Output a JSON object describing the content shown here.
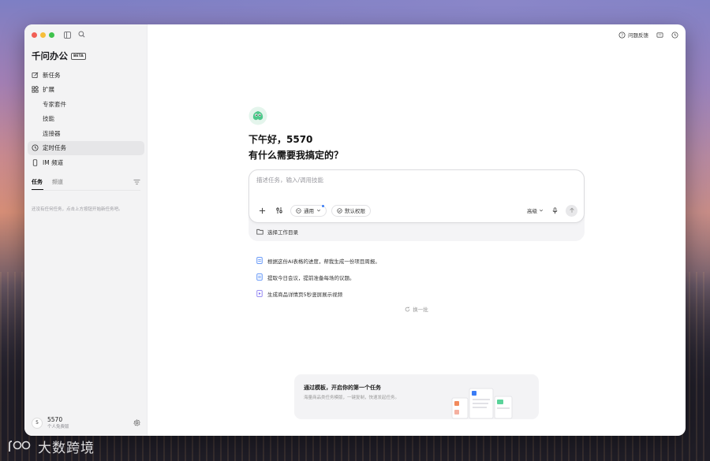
{
  "app": {
    "title": "千问办公",
    "badge": "BETA"
  },
  "sidebar": {
    "items": [
      {
        "label": "新任务",
        "icon": "edit-icon"
      },
      {
        "label": "扩展",
        "icon": "extension-icon"
      },
      {
        "label": "专家套件",
        "icon": ""
      },
      {
        "label": "技能",
        "icon": ""
      },
      {
        "label": "连接器",
        "icon": ""
      },
      {
        "label": "定时任务",
        "icon": "clock-icon"
      },
      {
        "label": "IM 频道",
        "icon": "phone-icon"
      }
    ],
    "tabs": [
      "任务",
      "频道"
    ],
    "empty_text": "还没有任何任务，点击上方按钮开始新任务吧。",
    "user": {
      "avatar": "5",
      "name": "5570",
      "plan": "个人免费版"
    }
  },
  "topbar": {
    "feedback_label": "问题反馈"
  },
  "main": {
    "greeting": "下午好，5570",
    "question": "有什么需要我搞定的？",
    "prompt_placeholder": "描述任务，输入/调用技能",
    "mode_label": "通用",
    "permission_label": "默认权限",
    "advanced_label": "高级",
    "workdir_label": "选择工作目录",
    "suggestions": [
      "根据这份AI表格的进度，帮我生成一份项目周报。",
      "提取今日会议，提前准备每场的议题。",
      "生成商品详情页5秒竖屏展示视频"
    ],
    "refresh_label": "换一批"
  },
  "banner": {
    "title": "通过模板，开启你的第一个任务",
    "subtitle": "海量商品类任务模版，一键复制，快速发起任务。"
  },
  "watermark": "大数跨境",
  "colors": {
    "accent": "#3b7cf5",
    "sidebar_bg": "#f3f3f4",
    "mascot": "#4cc88a"
  }
}
